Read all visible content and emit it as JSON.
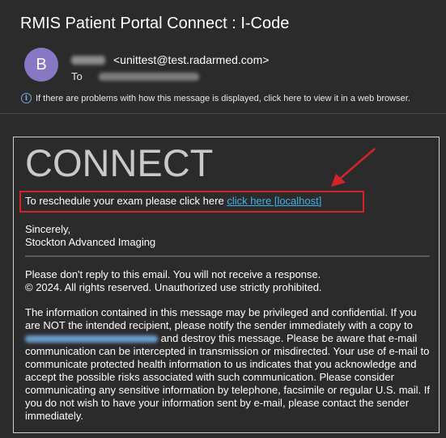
{
  "email": {
    "subject": "RMIS Patient Portal Connect : I-Code",
    "avatar_letter": "B",
    "sender_email": "<unittest@test.radarmed.com>",
    "to_label": "To",
    "info_text": "If there are problems with how this message is displayed, click here to view it in a web browser."
  },
  "body": {
    "logo_text": "CONNECT",
    "reschedule_text": "To reschedule your exam please click here",
    "reschedule_link": "click here [localhost]",
    "sincerely": "Sincerely,",
    "org_name": "Stockton Advanced Imaging",
    "no_reply": "Please don't reply to this email. You will not receive a response.",
    "copyright": "© 2024. All rights reserved. Unauthorized use strictly prohibited.",
    "disclaimer_part1": "The information contained in this message may be privileged and confidential. If you are NOT the intended recipient, please notify the sender immediately with a copy to",
    "disclaimer_part2": "and destroy this message. Please be aware that e-mail communication can be intercepted in transmission or misdirected. Your use of e-mail to communicate protected health information to us indicates that you acknowledge and accept the possible risks associated with such communication. Please consider communicating any sensitive information by telephone, facsimile or regular U.S. mail. If you do not wish to have your information sent by e-mail, please contact the sender immediately."
  },
  "colors": {
    "background": "#2b2b2b",
    "avatar": "#8878c3",
    "link": "#3fb3e8",
    "highlight": "#d2232a"
  }
}
